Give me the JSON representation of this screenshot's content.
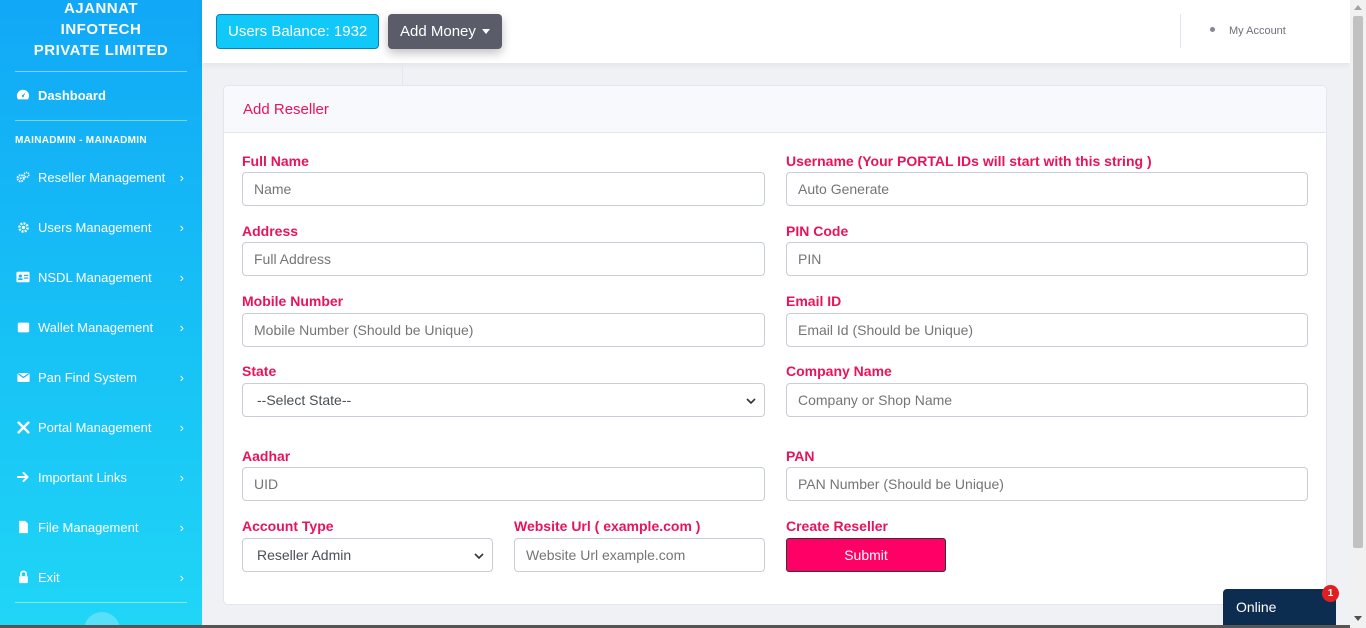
{
  "brand": {
    "line1": "AJANNAT",
    "line2": "INFOTECH",
    "line3": "PRIVATE LIMITED"
  },
  "sidebar": {
    "dashboard": "Dashboard",
    "section": "MAINADMIN - MAINADMIN",
    "items": [
      {
        "label": "Reseller Management",
        "icon": "cogs-icon"
      },
      {
        "label": "Users Management",
        "icon": "gear-icon"
      },
      {
        "label": "NSDL Management",
        "icon": "id-card-icon"
      },
      {
        "label": "Wallet Management",
        "icon": "wallet-icon"
      },
      {
        "label": "Pan Find System",
        "icon": "envelope-icon"
      },
      {
        "label": "Portal Management",
        "icon": "tools-icon"
      },
      {
        "label": "Important Links",
        "icon": "arrow-right-icon"
      },
      {
        "label": "File Management",
        "icon": "file-icon"
      },
      {
        "label": "Exit",
        "icon": "lock-icon"
      }
    ]
  },
  "topbar": {
    "balance": "Users Balance: 1932",
    "add_money": "Add Money",
    "account": "My Account"
  },
  "card": {
    "title": "Add Reseller"
  },
  "form": {
    "full_name": {
      "label": "Full Name",
      "placeholder": "Name"
    },
    "username": {
      "label": "Username (Your PORTAL IDs will start with this string )",
      "placeholder": "Auto Generate"
    },
    "address": {
      "label": "Address",
      "placeholder": "Full Address"
    },
    "pin": {
      "label": "PIN Code",
      "placeholder": "PIN"
    },
    "mobile": {
      "label": "Mobile Number",
      "placeholder": "Mobile Number (Should be Unique)"
    },
    "email": {
      "label": "Email ID",
      "placeholder": "Email Id (Should be Unique)"
    },
    "state": {
      "label": "State",
      "selected": "--Select State--"
    },
    "company": {
      "label": "Company Name",
      "placeholder": "Company or Shop Name"
    },
    "aadhar": {
      "label": "Aadhar",
      "placeholder": "UID"
    },
    "pan": {
      "label": "PAN",
      "placeholder": "PAN Number (Should be Unique)"
    },
    "account_type": {
      "label": "Account Type",
      "selected": "Reseller Admin"
    },
    "website": {
      "label": "Website Url ( example.com )",
      "placeholder": "Website Url example.com"
    },
    "create": {
      "label": "Create Reseller",
      "button": "Submit"
    }
  },
  "chat": {
    "label": "Online",
    "badge": "1"
  },
  "colors": {
    "accent": "#e8135a",
    "sidebar": "#17c2f5",
    "submit": "#ff0066"
  }
}
